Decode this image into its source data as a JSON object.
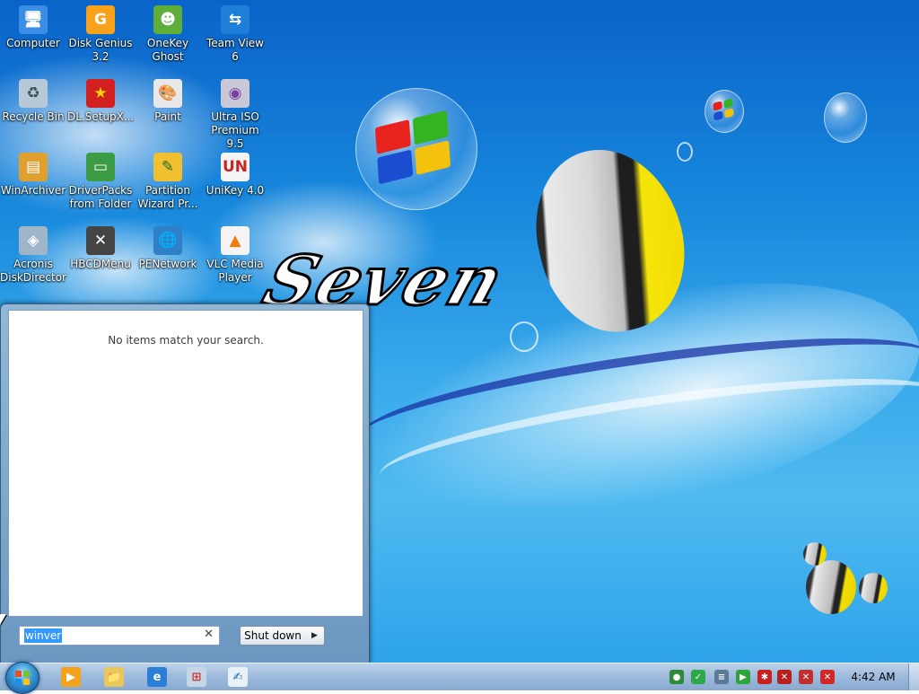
{
  "desktop": {
    "icons": [
      {
        "name": "computer",
        "label": "Computer",
        "glyph": "🖥"
      },
      {
        "name": "disk-genius",
        "label": "Disk Genius\n3.2",
        "glyph": "G"
      },
      {
        "name": "onekey-ghost",
        "label": "OneKey\nGhost",
        "glyph": "☻"
      },
      {
        "name": "team-view",
        "label": "Team View 6",
        "glyph": "⇆"
      },
      {
        "name": "recycle-bin",
        "label": "Recycle Bin",
        "glyph": "♻"
      },
      {
        "name": "dl-setup",
        "label": "DL.SetupX...",
        "glyph": "★"
      },
      {
        "name": "paint",
        "label": "Paint",
        "glyph": "🎨"
      },
      {
        "name": "ultra-iso",
        "label": "Ultra ISO\nPremium 9.5",
        "glyph": "◉"
      },
      {
        "name": "winarchiver",
        "label": "WinArchiver",
        "glyph": "▤"
      },
      {
        "name": "driverpacks",
        "label": "DriverPacks\nfrom Folder",
        "glyph": "▭"
      },
      {
        "name": "partition-wizard",
        "label": "Partition\nWizard Pr...",
        "glyph": "✎"
      },
      {
        "name": "unikey",
        "label": "UniKey 4.0",
        "glyph": "UN"
      },
      {
        "name": "acronis",
        "label": "Acronis\nDiskDirector",
        "glyph": "◈"
      },
      {
        "name": "hbcdmenu",
        "label": "HBCDMenu",
        "glyph": "✕"
      },
      {
        "name": "penetwork",
        "label": "PENetwork",
        "glyph": "🌐"
      },
      {
        "name": "vlc",
        "label": "VLC Media\nPlayer",
        "glyph": "▲"
      }
    ],
    "wallpaper_text": "Seven"
  },
  "start_menu": {
    "no_results_text": "No items match your search.",
    "search_value": "winver",
    "clear_glyph": "✕",
    "shutdown_label": "Shut down",
    "shutdown_arrow": "▶"
  },
  "taskbar": {
    "pinned": [
      {
        "name": "media-player",
        "glyph": "▶"
      },
      {
        "name": "explorer",
        "glyph": "📁"
      },
      {
        "name": "internet-explorer",
        "glyph": "e"
      },
      {
        "name": "network-tool",
        "glyph": "⊞"
      },
      {
        "name": "paint-tool",
        "glyph": "✍"
      }
    ],
    "tray": [
      {
        "name": "network-globe",
        "glyph": "●"
      },
      {
        "name": "security-check",
        "glyph": "✓"
      },
      {
        "name": "stack-app",
        "glyph": "≡"
      },
      {
        "name": "play-app",
        "glyph": "▶"
      },
      {
        "name": "red-app",
        "glyph": "✱"
      },
      {
        "name": "red-app-2",
        "glyph": "✕"
      },
      {
        "name": "display-error",
        "glyph": "✕"
      },
      {
        "name": "volume-muted",
        "glyph": "✕"
      }
    ],
    "clock": "4:42 AM"
  }
}
